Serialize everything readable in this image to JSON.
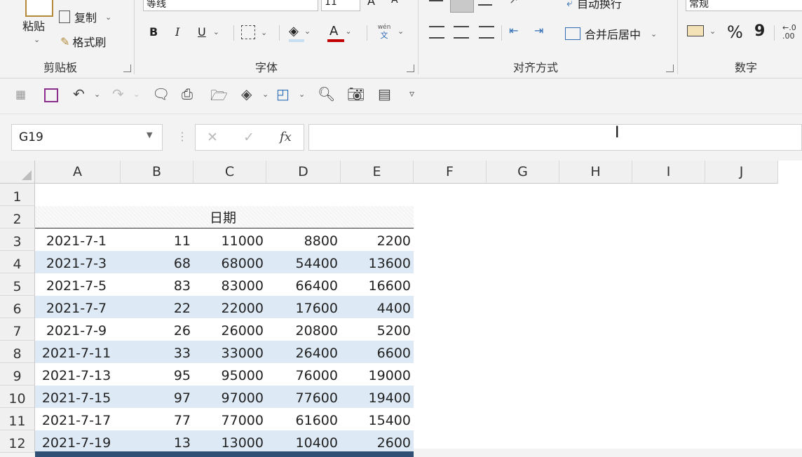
{
  "ribbon": {
    "clipboard": {
      "paste": "粘贴",
      "copy": "复制",
      "format_painter": "格式刷",
      "group": "剪贴板"
    },
    "font": {
      "name": "等线",
      "size": "11",
      "bold": "B",
      "italic": "I",
      "underline": "U",
      "color_glyph": "A",
      "phonetic_top": "wén",
      "phonetic_bottom": "文",
      "group": "字体",
      "grow": "A",
      "shrink": "A"
    },
    "alignment": {
      "wrap": "自动换行",
      "merge": "合并后居中",
      "group": "对齐方式"
    },
    "number": {
      "format": "常规",
      "percent": "%",
      "comma": "9",
      "group": "数字",
      "decimal": "←.0\n.00"
    }
  },
  "formula_bar": {
    "name_box": "G19",
    "fx": "fx",
    "cancel": "✕",
    "enter": "✓",
    "formula": ""
  },
  "grid": {
    "columns": [
      "A",
      "B",
      "C",
      "D",
      "E",
      "F",
      "G",
      "H",
      "I",
      "J"
    ],
    "row_numbers": [
      "1",
      "2",
      "3",
      "4",
      "5",
      "6",
      "7",
      "8",
      "9",
      "10",
      "11",
      "12"
    ],
    "title": "日期",
    "rows": [
      [
        "2021-7-1",
        "11",
        "11000",
        "8800",
        "2200"
      ],
      [
        "2021-7-3",
        "68",
        "68000",
        "54400",
        "13600"
      ],
      [
        "2021-7-5",
        "83",
        "83000",
        "66400",
        "16600"
      ],
      [
        "2021-7-7",
        "22",
        "22000",
        "17600",
        "4400"
      ],
      [
        "2021-7-9",
        "26",
        "26000",
        "20800",
        "5200"
      ],
      [
        "2021-7-11",
        "33",
        "33000",
        "26400",
        "6600"
      ],
      [
        "2021-7-13",
        "95",
        "95000",
        "76000",
        "19000"
      ],
      [
        "2021-7-15",
        "97",
        "97000",
        "77600",
        "19400"
      ],
      [
        "2021-7-17",
        "77",
        "77000",
        "61600",
        "15400"
      ],
      [
        "2021-7-19",
        "13",
        "13000",
        "10400",
        "2600"
      ]
    ]
  },
  "colors": {
    "band": "#ddeaf6",
    "accent_purple": "#8b2f8f",
    "font_color_red": "#c00000"
  }
}
